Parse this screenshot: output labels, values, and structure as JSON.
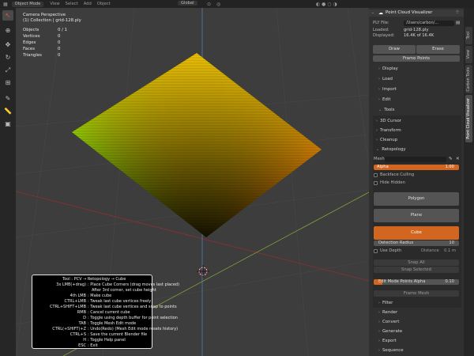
{
  "header": {
    "mode": "Object Mode",
    "menu": [
      "View",
      "Select",
      "Add",
      "Object"
    ],
    "transform": "Global"
  },
  "viewport": {
    "stats": {
      "title": "Camera Perspective",
      "collection": "(1) Collection | grid-128.ply",
      "objects_label": "Objects",
      "objects_value": "0 / 1",
      "vertices_label": "Vertices",
      "vertices_value": "0",
      "edges_label": "Edges",
      "edges_value": "0",
      "faces_label": "Faces",
      "faces_value": "0",
      "triangles_label": "Triangles",
      "triangles_value": "0"
    },
    "help": {
      "rows": [
        {
          "key": "",
          "desc": "Tool : PCV → Retopology → Cube"
        },
        {
          "key": "3x LMB(+drag)",
          "desc": ": Place Cube Corners (drag moves last placed)"
        },
        {
          "key": "",
          "desc": "After 3rd corner, set cube height"
        },
        {
          "key": "4th LMB",
          "desc": ": Make cube"
        },
        {
          "key": "CTRL+LMB",
          "desc": ": Tweak last cube vertices freely"
        },
        {
          "key": "CTRL+SHIFT+LMB",
          "desc": ": Tweak last cube vertices and snap to points"
        },
        {
          "key": "RMB",
          "desc": ": Cancel current cube"
        },
        {
          "key": "D",
          "desc": ": Toggle using depth buffer for point selection"
        },
        {
          "key": "TAB",
          "desc": ": Toggle Mesh Edit mode"
        },
        {
          "key": "CTRL(+SHIFT)+Z",
          "desc": ": Undo(Redo) (Mesh Edit mode resets history)"
        },
        {
          "key": "CTRL+S",
          "desc": ": Save the current Blender file"
        },
        {
          "key": "H",
          "desc": ": Toggle Help panel"
        },
        {
          "key": "ESC",
          "desc": ": Exit"
        }
      ]
    }
  },
  "panel": {
    "title": "Point Cloud Visualizer",
    "ply_file_label": "PLY File:",
    "ply_file_value": "/Users/carbon/...",
    "loaded_label": "Loaded:",
    "loaded_value": "grid-128.ply",
    "displayed_label": "Displayed:",
    "displayed_value": "16.4K of 16.4K",
    "draw_label": "Draw",
    "erase_label": "Erase",
    "frame_points_label": "Frame Points",
    "sections_top": [
      "Display",
      "Load",
      "Import",
      "Edit"
    ],
    "tools_label": "Tools",
    "tools_sub": [
      "3D Cursor",
      "Transform",
      "Cleanup"
    ],
    "retopology_label": "Retopology",
    "mesh_label": "Mesh",
    "alpha_label": "Alpha",
    "alpha_value": "1.00",
    "alpha_fraction": 1.0,
    "backface_label": "Backface Culling",
    "hide_hidden_label": "Hide Hidden",
    "polygon_label": "Polygon",
    "plane_label": "Plane",
    "cube_label": "Cube",
    "detection_radius_label": "Detection Radius",
    "detection_radius_value": "10",
    "use_depth_label": "Use Depth",
    "distance_label": "Distance",
    "distance_value": "0.1 m",
    "snap_all_label": "Snap All",
    "snap_selected_label": "Snap Selected",
    "edit_alpha_label": "Edit Mode Points Alpha",
    "edit_alpha_value": "0.10",
    "edit_alpha_fraction": 0.1,
    "frame_mesh_label": "Frame Mesh",
    "sections_bottom": [
      "Filter",
      "Render",
      "Convert",
      "Generate",
      "Export",
      "Sequence"
    ]
  },
  "tabs": [
    "Tool",
    "View",
    "Carbon Tools",
    "Point Cloud Visualizer"
  ],
  "colors": {
    "accent": "#d2651f",
    "viewport_bg": "#3d3d3d",
    "panel_bg": "#303030",
    "axis_x": "#8f2f30",
    "axis_y": "#7ea33a",
    "axis_z": "#4f7fb9"
  }
}
